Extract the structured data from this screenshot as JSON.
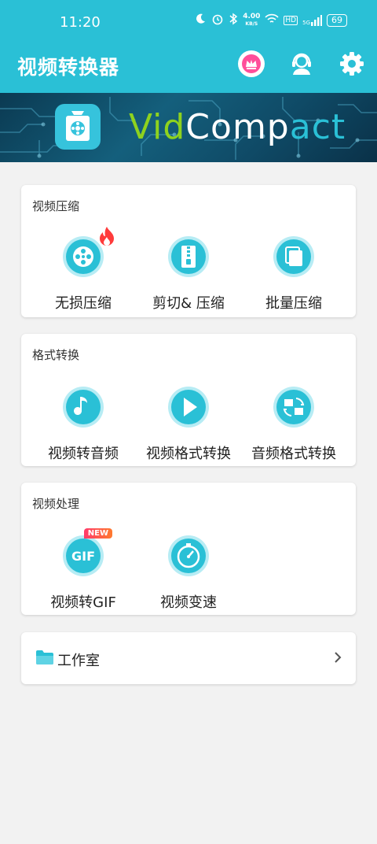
{
  "status_bar": {
    "time": "11:20",
    "net_speed": "4.00",
    "net_unit": "KB/S",
    "hd": "HD",
    "signal": "5G",
    "battery": "69"
  },
  "app_bar": {
    "title": "视频转换器",
    "icons": [
      "crown-icon",
      "support-icon",
      "gear-icon"
    ]
  },
  "banner": {
    "brand_part1": "Vid",
    "brand_part2": "Comp",
    "brand_part3": "act"
  },
  "sections": {
    "compress": {
      "title": "视频压缩",
      "items": [
        {
          "label": "无损压缩",
          "icon": "film-reel-icon",
          "hot": true
        },
        {
          "label": "剪切& 压缩",
          "icon": "zipper-icon"
        },
        {
          "label": "批量压缩",
          "icon": "copy-stack-icon"
        }
      ]
    },
    "format": {
      "title": "格式转换",
      "items": [
        {
          "label": "视频转音频",
          "icon": "music-note-icon"
        },
        {
          "label": "视频格式转换",
          "icon": "play-icon"
        },
        {
          "label": "音频格式转换",
          "icon": "convert-icon"
        }
      ]
    },
    "process": {
      "title": "视频处理",
      "items": [
        {
          "label": "视频转GIF",
          "icon": "gif-icon",
          "badge": "NEW",
          "icon_text": "GIF"
        },
        {
          "label": "视频变速",
          "icon": "speedometer-icon"
        }
      ]
    }
  },
  "workshop": {
    "label": "工作室"
  },
  "colors": {
    "primary": "#2ac0d6",
    "icon_ring": "#5fd3e4",
    "hot": "#ff3b3b",
    "background": "#f2f2f2"
  }
}
